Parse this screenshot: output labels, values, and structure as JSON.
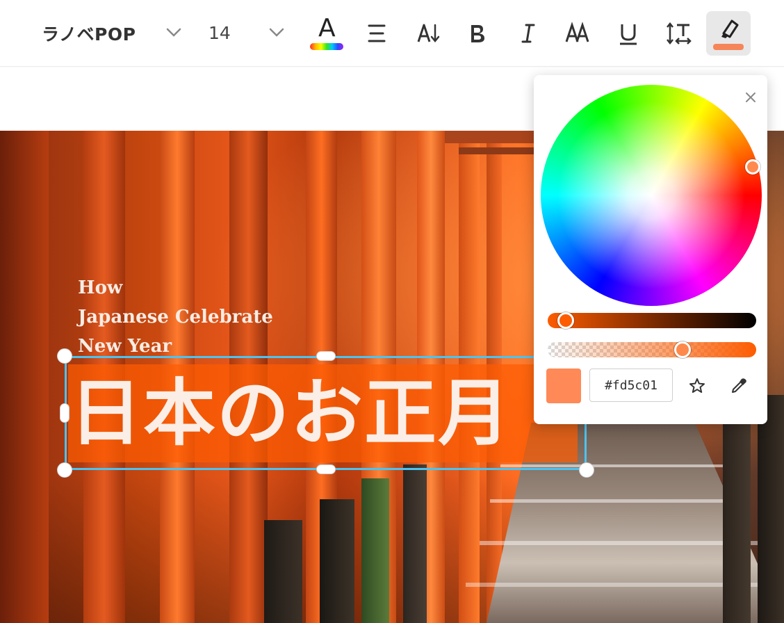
{
  "toolbar": {
    "font_name": "ラノベPOP",
    "font_size": "14",
    "text_color_glyph": "A",
    "icons": [
      "chevron-down-icon",
      "align-icon",
      "text-direction-icon",
      "bold-icon",
      "italic-icon",
      "font-case-icon",
      "underline-icon",
      "spacing-icon",
      "highlighter-icon"
    ],
    "highlight_color": "#f6865a"
  },
  "canvas": {
    "subtitle_lines": [
      "How",
      "Japanese Celebrate",
      "New Year"
    ],
    "headline": "日本のお正月"
  },
  "color_picker": {
    "hex_value": "#fd5c01",
    "swatch_color": "#ff8a57",
    "shade_position": 0.05,
    "alpha_position": 0.66,
    "icons": [
      "close-icon",
      "star-icon",
      "eyedropper-icon"
    ]
  }
}
